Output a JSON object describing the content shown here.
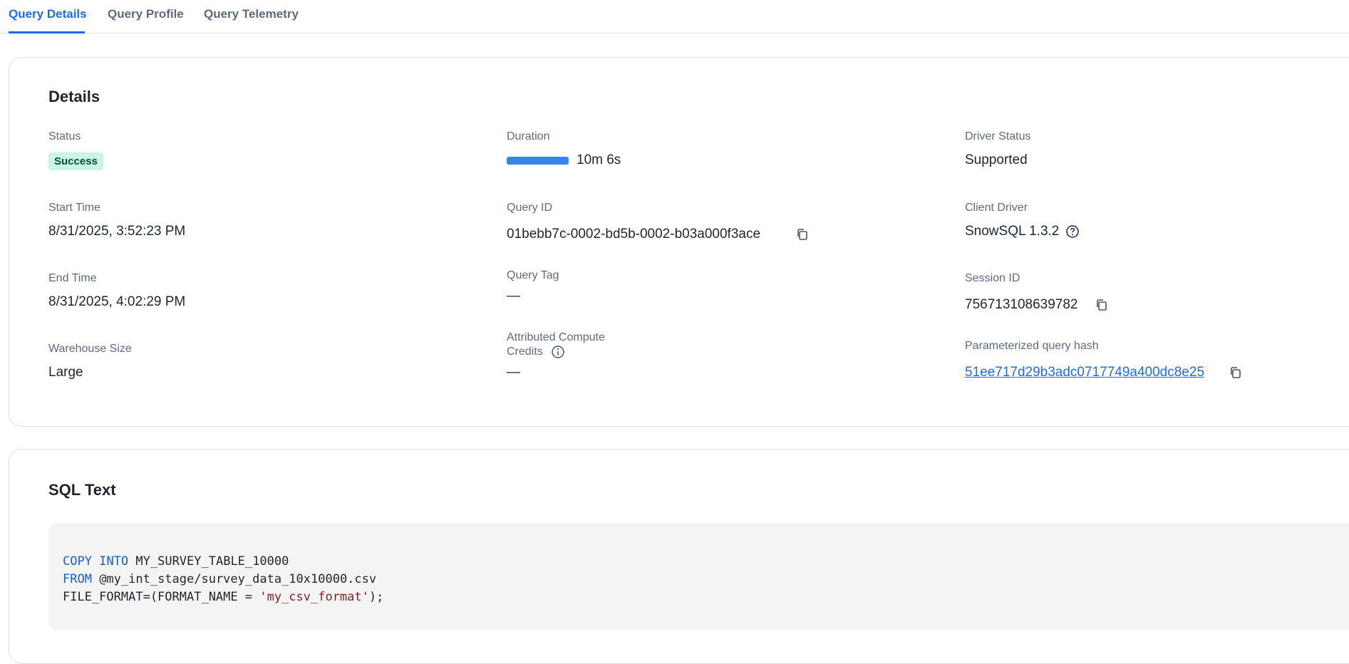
{
  "tabs": [
    {
      "label": "Query Details",
      "active": true
    },
    {
      "label": "Query Profile",
      "active": false
    },
    {
      "label": "Query Telemetry",
      "active": false
    }
  ],
  "details": {
    "title": "Details",
    "status": {
      "label": "Status",
      "value": "Success",
      "color": "#c8f5e6"
    },
    "duration": {
      "label": "Duration",
      "value": "10m 6s"
    },
    "driver_status": {
      "label": "Driver Status",
      "value": "Supported"
    },
    "start_time": {
      "label": "Start Time",
      "value": "8/31/2025, 3:52:23 PM"
    },
    "query_id": {
      "label": "Query ID",
      "value": "01bebb7c-0002-bd5b-0002-b03a000f3ace"
    },
    "client_driver": {
      "label": "Client Driver",
      "value": "SnowSQL 1.3.2"
    },
    "end_time": {
      "label": "End Time",
      "value": "8/31/2025, 4:02:29 PM"
    },
    "query_tag": {
      "label": "Query Tag",
      "value": "—"
    },
    "session_id": {
      "label": "Session ID",
      "value": "756713108639782"
    },
    "warehouse_size": {
      "label": "Warehouse Size",
      "value": "Large"
    },
    "compute_credits": {
      "label_line1": "Attributed Compute",
      "label_line2": "Credits",
      "value": "—"
    },
    "query_hash": {
      "label": "Parameterized query hash",
      "value": "51ee717d29b3adc0717749a400dc8e25"
    }
  },
  "sql": {
    "title": "SQL Text",
    "line1_kw1": "COPY",
    "line1_kw2": "INTO",
    "line1_rest": " MY_SURVEY_TABLE_10000",
    "line2_kw": "FROM",
    "line2_rest": " @my_int_stage/survey_data_10x10000.csv",
    "line3_pre": "FILE_FORMAT=(FORMAT_NAME = ",
    "line3_str": "'my_csv_format'",
    "line3_post": ");"
  },
  "icons": {
    "copy": "copy-icon",
    "help": "help-circle-icon",
    "info": "info-circle-icon"
  },
  "colors": {
    "accent": "#1a6ce7",
    "duration_bar": "#3b82f0",
    "success_badge": "#c8f5e6"
  }
}
